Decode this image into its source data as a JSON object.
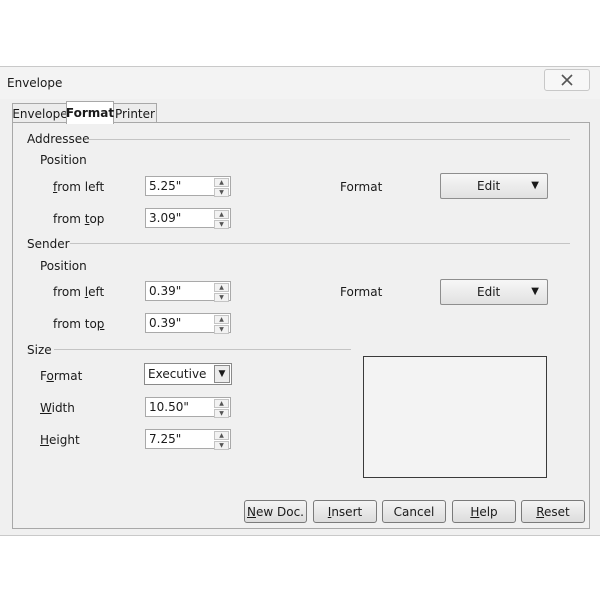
{
  "window": {
    "title": "Envelope"
  },
  "tabs": [
    {
      "label": "Envelope"
    },
    {
      "label": "Format"
    },
    {
      "label": "Printer"
    }
  ],
  "addressee": {
    "heading": "Addressee",
    "position_label": "Position",
    "from_left": {
      "prefix": "",
      "underlined": "f",
      "suffix": "rom left",
      "value": "5.25\""
    },
    "from_top": {
      "prefix": "from ",
      "underlined": "t",
      "suffix": "op",
      "value": "3.09\""
    },
    "format_label": "Format",
    "edit_label": "Edit"
  },
  "sender": {
    "heading": "Sender",
    "position_label": "Position",
    "from_left": {
      "prefix": "from ",
      "underlined": "l",
      "suffix": "eft",
      "value": "0.39\""
    },
    "from_top": {
      "prefix": "from to",
      "underlined": "p",
      "suffix": "",
      "value": "0.39\""
    },
    "format_label": "Format",
    "edit_label": "Edit"
  },
  "size": {
    "heading": "Size",
    "format": {
      "prefix": "F",
      "underlined": "o",
      "suffix": "rmat",
      "value": "Executive"
    },
    "width": {
      "prefix": "",
      "underlined": "W",
      "suffix": "idth",
      "value": "10.50\""
    },
    "height": {
      "prefix": "",
      "underlined": "H",
      "suffix": "eight",
      "value": "7.25\""
    }
  },
  "buttons": {
    "new_doc": {
      "prefix": "",
      "underlined": "N",
      "suffix": "ew Doc."
    },
    "insert": {
      "prefix": "",
      "underlined": "I",
      "suffix": "nsert"
    },
    "cancel": {
      "label": "Cancel"
    },
    "help": {
      "prefix": "",
      "underlined": "H",
      "suffix": "elp"
    },
    "reset": {
      "prefix": "",
      "underlined": "R",
      "suffix": "eset"
    }
  }
}
